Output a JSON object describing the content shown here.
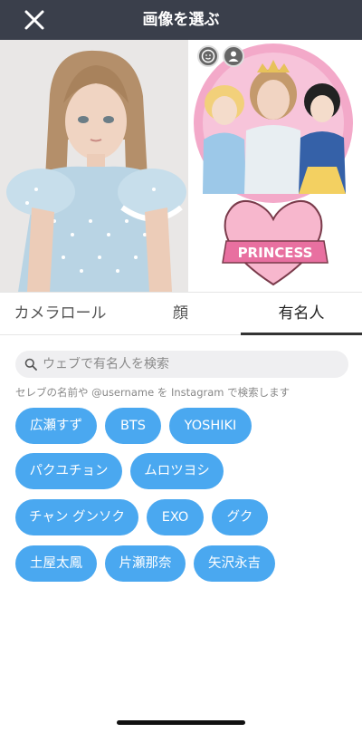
{
  "header": {
    "title": "画像を選ぶ",
    "close_icon": "close-icon"
  },
  "photos": {
    "overlay_icons": [
      "face-icon",
      "person-icon"
    ],
    "banner_text": "PRINCESS"
  },
  "tabs": [
    {
      "label": "カメラロール",
      "active": false
    },
    {
      "label": "顔",
      "active": false
    },
    {
      "label": "有名人",
      "active": true
    }
  ],
  "search": {
    "placeholder": "ウェブで有名人を検索",
    "value": ""
  },
  "hint": "セレブの名前や @username を Instagram で検索します",
  "celebrities": [
    "広瀬すず",
    "BTS",
    "YOSHIKI",
    "パクユチョン",
    "ムロツヨシ",
    "チャン グンソク",
    "EXO",
    "グク",
    "土屋太鳳",
    "片瀬那奈",
    "矢沢永吉"
  ],
  "colors": {
    "topbar": "#3a3f4b",
    "chip": "#4aa8f0",
    "active_tab_underline": "#333333"
  }
}
